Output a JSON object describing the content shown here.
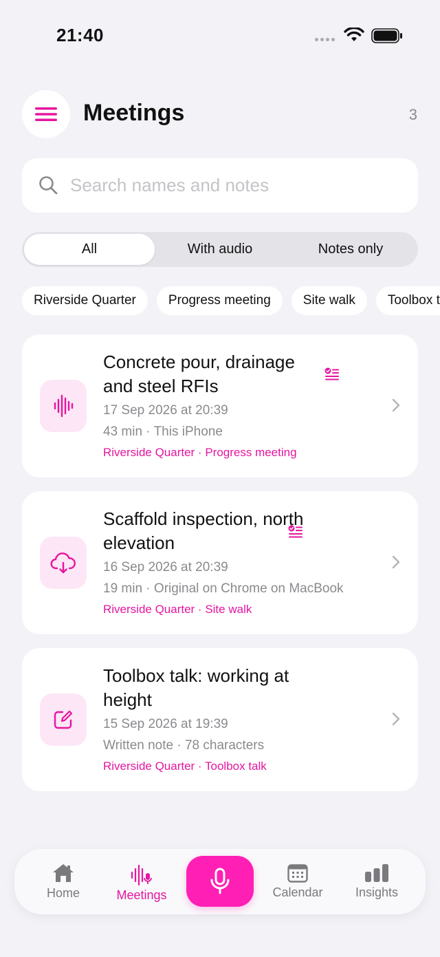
{
  "status_bar": {
    "time": "21:40"
  },
  "header": {
    "title": "Meetings",
    "count": "3"
  },
  "search": {
    "placeholder": "Search names and notes",
    "value": ""
  },
  "segments": [
    "All",
    "With audio",
    "Notes only"
  ],
  "chips": [
    "Riverside Quarter",
    "Progress meeting",
    "Site walk",
    "Toolbox talk"
  ],
  "meetings": [
    {
      "title": "Concrete pour, drainage and steel RFIs",
      "date": "17 Sep 2026 at 20:39",
      "meta": "43 min · This iPhone",
      "tags": "Riverside Quarter · Progress meeting",
      "icon": "waveform-icon",
      "has_summary": true
    },
    {
      "title": "Scaffold inspection, north elevation",
      "date": "16 Sep 2026 at 20:39",
      "meta": "19 min · Original on Chrome on MacBook",
      "tags": "Riverside Quarter · Site walk",
      "icon": "cloud-download-icon",
      "has_summary": true
    },
    {
      "title": "Toolbox talk: working at height",
      "date": "15 Sep 2026 at 19:39",
      "meta": "Written note · 78 characters",
      "tags": "Riverside Quarter · Toolbox talk",
      "icon": "note-edit-icon",
      "has_summary": false
    }
  ],
  "tab_bar": {
    "home": "Home",
    "meetings": "Meetings",
    "calendar": "Calendar",
    "insights": "Insights"
  },
  "colors": {
    "accent": "#E5159F",
    "record": "#FF1FB4",
    "icon_bg": "#FDE6F6",
    "background": "#F2F2F7"
  }
}
